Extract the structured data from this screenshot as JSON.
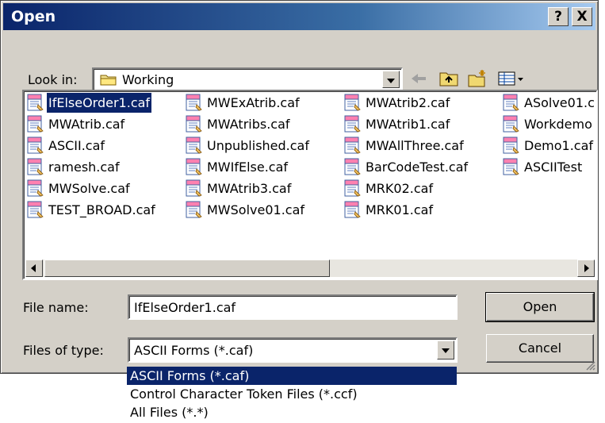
{
  "title": "Open",
  "title_buttons": {
    "help": "?",
    "close": "X"
  },
  "look_in": {
    "label": "Look in:",
    "value": "Working",
    "icon": "folder-icon"
  },
  "toolbar": {
    "icons": [
      "back-arrow-icon",
      "up-folder-icon",
      "new-folder-icon",
      "view-menu-icon"
    ]
  },
  "files": [
    [
      "IfElseOrder1.caf",
      "MWAtrib.caf",
      "ASCII.caf",
      "ramesh.caf",
      "MWSolve.caf",
      "TEST_BROAD.caf"
    ],
    [
      "MWExAtrib.caf",
      "MWAtribs.caf",
      "Unpublished.caf",
      "MWIfElse.caf",
      "MWAtrib3.caf",
      "MWSolve01.caf"
    ],
    [
      "MWAtrib2.caf",
      "MWAtrib1.caf",
      "MWAllThree.caf",
      "BarCodeTest.caf",
      "MRK02.caf",
      "MRK01.caf"
    ],
    [
      "ASolve01.c",
      "Workdemo",
      "Demo1.caf",
      "ASCIITest"
    ]
  ],
  "selected_file": "IfElseOrder1.caf",
  "file_name": {
    "label": "File name:",
    "value": "IfElseOrder1.caf"
  },
  "file_type": {
    "label": "Files of type:",
    "value": "ASCII Forms (*.caf)",
    "options": [
      "ASCII Forms (*.caf)",
      "Control Character Token Files (*.ccf)",
      "All Files (*.*)"
    ],
    "selected_index": 0
  },
  "buttons": {
    "open": "Open",
    "cancel": "Cancel"
  },
  "colors": {
    "titlebar": "#0a246a",
    "selection": "#0a246a",
    "dialog": "#d4d0c8"
  }
}
